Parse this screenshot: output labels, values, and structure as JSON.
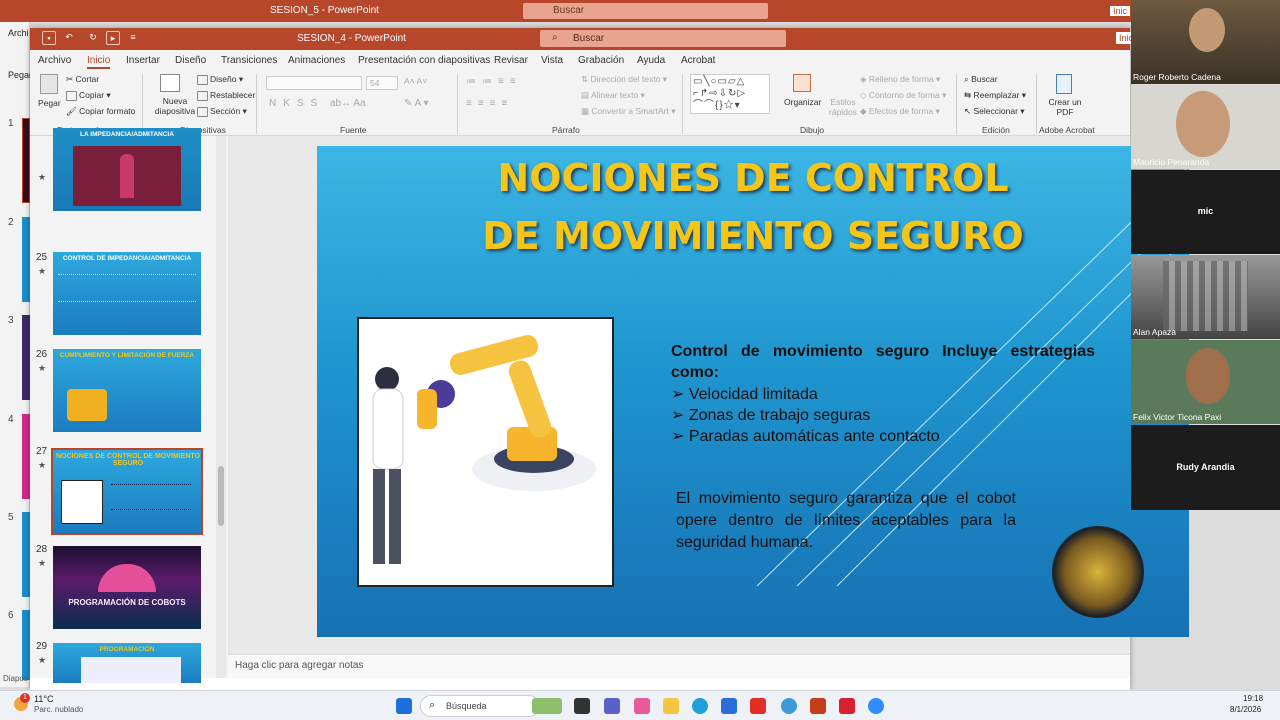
{
  "back_window": {
    "title": "SESION_5 - PowerPoint",
    "search": "Buscar",
    "menu_partial": "Archi",
    "paste_partial": "Pegar",
    "slide_numbers": [
      "1",
      "2",
      "3",
      "4",
      "5",
      "6"
    ],
    "status_partial": "Diapos",
    "user_partial": "Inic"
  },
  "window": {
    "title": "SESION_4 - PowerPoint",
    "search": "Buscar",
    "user_partial": "Inic"
  },
  "menu": [
    "Archivo",
    "Inicio",
    "Insertar",
    "Diseño",
    "Transiciones",
    "Animaciones",
    "Presentación con diapositivas",
    "Revisar",
    "Vista",
    "Grabación",
    "Ayuda",
    "Acrobat"
  ],
  "ribbon": {
    "paste": "Pegar",
    "cut": "Cortar",
    "copy": "Copiar",
    "format_painter": "Copiar formato",
    "clipboard_group": "Portapapeles",
    "new_slide": "Nueva diapositiva",
    "layout": "Diseño",
    "reset": "Restablecer",
    "section": "Sección",
    "slides_group": "Diapositivas",
    "font_size": "54",
    "font_group": "Fuente",
    "text_direction": "Dirección del texto",
    "align_text": "Alinear texto",
    "smartart": "Convertir a SmartArt",
    "paragraph_group": "Párrafo",
    "arrange": "Organizar",
    "quick_styles": "Estilos rápidos",
    "shape_fill": "Relleno de forma",
    "shape_outline": "Contorno de forma",
    "shape_effects": "Efectos de forma",
    "drawing_group": "Dibujo",
    "find": "Buscar",
    "replace": "Reemplazar",
    "select": "Seleccionar",
    "editing_group": "Edición",
    "create_pdf": "Crear un PDF",
    "acrobat_group": "Adobe Acrobat"
  },
  "thumbnails": [
    {
      "num": "",
      "title": "LA IMPEDANCIA/ADMITANCIA"
    },
    {
      "num": "25",
      "title": "CONTROL DE IMPEDANCIA/ADMITANCIA"
    },
    {
      "num": "26",
      "title": "CUMPLIMIENTO Y LIMITACIÓN DE FUERZA"
    },
    {
      "num": "27",
      "title": "NOCIONES DE CONTROL DE MOVIMIENTO SEGURO"
    },
    {
      "num": "28",
      "title": "PROGRAMACIÓN DE COBOTS"
    },
    {
      "num": "29",
      "title": "PROGRAMACIÓN"
    }
  ],
  "slide": {
    "title_line1": "NOCIONES DE CONTROL",
    "title_line2": "DE MOVIMIENTO SEGURO",
    "intro": "Control de movimiento seguro Incluye estrategias como:",
    "bullets": [
      "Velocidad limitada",
      "Zonas de trabajo seguras",
      "Paradas automáticas ante contacto"
    ],
    "paragraph": "El movimiento seguro garantiza que el cobot opere dentro de límites aceptables para la seguridad humana."
  },
  "notes_placeholder": "Haga clic para agregar notas",
  "participants": [
    {
      "name": "Roger Roberto Cadena"
    },
    {
      "name": "Mauricio Penaranda"
    },
    {
      "name": "mic"
    },
    {
      "name": "Alan Apaza"
    },
    {
      "name": "Felix Victor Ticona Paxi"
    },
    {
      "name": "Rudy Arandia"
    }
  ],
  "taskbar": {
    "weather_temp": "11°C",
    "weather_desc": "Parc. nublado",
    "search": "Búsqueda",
    "time": "19:18",
    "date": "8/1/2026",
    "notif_count": "1"
  }
}
